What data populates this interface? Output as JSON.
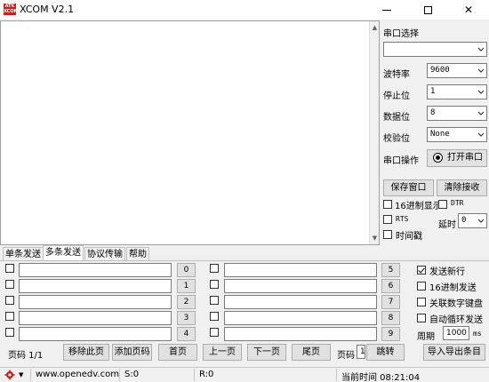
{
  "window": {
    "title": "XCOM V2.1",
    "icon_text_top": "ATK",
    "icon_text_bottom": "XCOM",
    "minimize_symbol": "",
    "close_symbol": "✕"
  },
  "receive": {
    "text": ""
  },
  "serial": {
    "port_select_label": "串口选择",
    "port_value": "",
    "baud_label": "波特率",
    "baud_value": "9600",
    "stop_label": "停止位",
    "stop_value": "1",
    "data_label": "数据位",
    "data_value": "8",
    "parity_label": "校验位",
    "parity_value": "None",
    "op_label": "串口操作",
    "open_button": "打开串口"
  },
  "recv_options": {
    "save_button": "保存窗口",
    "clear_button": "清除接收",
    "hex_display": "16进制显示",
    "dtr": "DTR",
    "rts": "RTS",
    "delay_label": "延时",
    "delay_value": "0",
    "timestamp": "时间戳"
  },
  "tabs": [
    "单条发送",
    "多条发送",
    "协议传输",
    "帮助"
  ],
  "active_tab": 1,
  "multi": {
    "left_buttons": [
      "0",
      "1",
      "2",
      "3",
      "4"
    ],
    "right_buttons": [
      "5",
      "6",
      "7",
      "8",
      "9"
    ]
  },
  "send_options": {
    "send_newline": "发送新行",
    "send_newline_checked": true,
    "hex_send": "16进制发送",
    "numeric_keypad": "关联数字键盘",
    "auto_loop": "自动循环发送",
    "period_label": "周期",
    "period_value": "1000",
    "period_unit": "ms"
  },
  "pager": {
    "page_info": "页码 1/1",
    "remove_page": "移除此页",
    "add_page": "添加页码",
    "first": "首页",
    "prev": "上一页",
    "next": "下一页",
    "last": "尾页",
    "page_label": "页码",
    "page_value": "1",
    "jump": "跳转",
    "import_export": "导入导出条目"
  },
  "status": {
    "url": "www.openedv.com",
    "sent": "S:0",
    "received": "R:0",
    "time": "当前时间 08:21:04"
  },
  "colors": {
    "accent_red": "#c9211e",
    "frame": "#f0f0f0"
  }
}
